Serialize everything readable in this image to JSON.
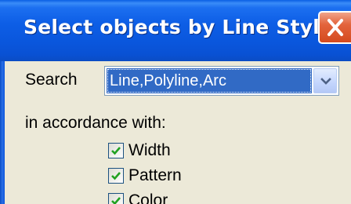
{
  "window": {
    "title": "Select objects by Line Style",
    "close_icon": "close-icon"
  },
  "form": {
    "search_label": "Search",
    "search_value": "Line,Polyline,Arc",
    "dropdown_icon": "chevron-down-icon",
    "accordance_label": "in accordance with:",
    "options": [
      {
        "label": "Width",
        "checked": true
      },
      {
        "label": "Pattern",
        "checked": true
      },
      {
        "label": "Color",
        "checked": true
      }
    ]
  },
  "colors": {
    "title_bar": "#0a56dc",
    "selection": "#316ac5",
    "close_button": "#e3643c",
    "dialog_background": "#ece9d8",
    "check_mark": "#21a121"
  }
}
